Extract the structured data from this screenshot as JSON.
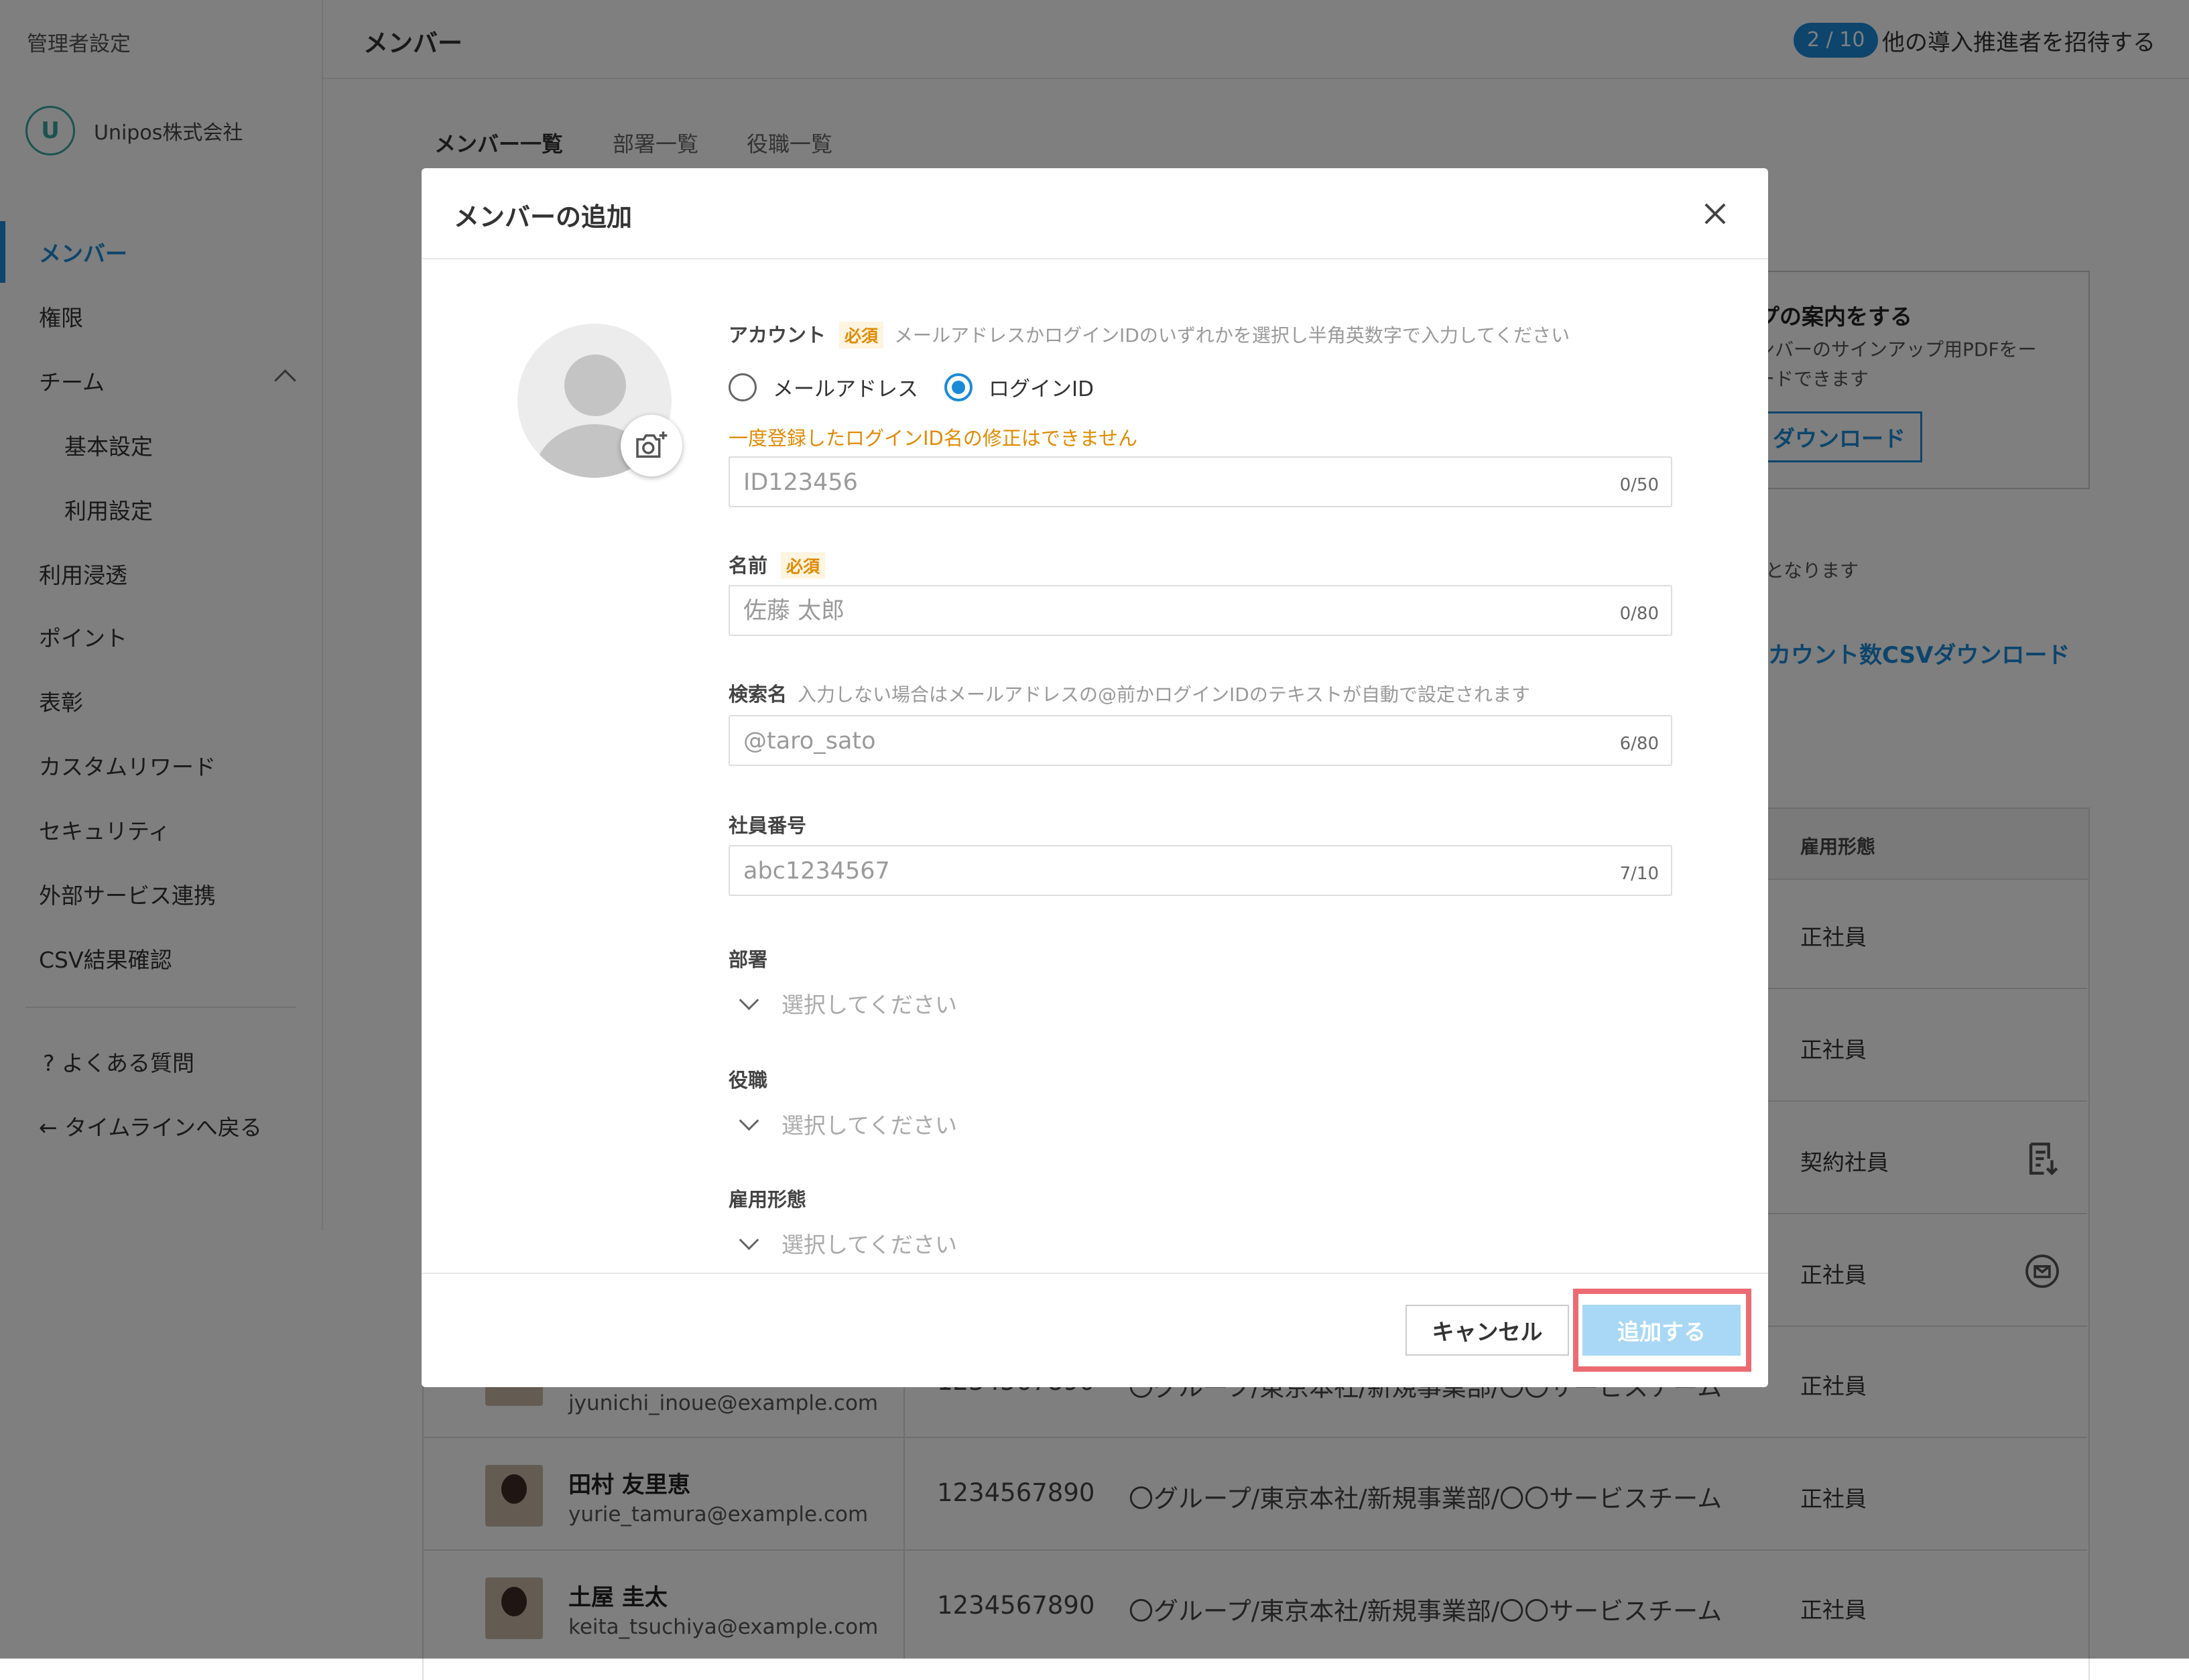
{
  "sidebar": {
    "header": "管理者設定",
    "company": "Unipos株式会社",
    "items": [
      {
        "label": "メンバー"
      },
      {
        "label": "権限"
      },
      {
        "label": "チーム"
      },
      {
        "label": "基本設定"
      },
      {
        "label": "利用設定"
      },
      {
        "label": "利用浸透"
      },
      {
        "label": "ポイント"
      },
      {
        "label": "表彰"
      },
      {
        "label": "カスタムリワード"
      },
      {
        "label": "セキュリティ"
      },
      {
        "label": "外部サービス連携"
      },
      {
        "label": "CSV結果確認"
      }
    ],
    "faq": "よくある質問",
    "back": "タイムラインへ戻る"
  },
  "topbar": {
    "title": "メンバー",
    "count": "2 / 10",
    "invite": "他の導入推進者を招待する"
  },
  "tabs": [
    "メンバー一覧",
    "部署一覧",
    "役職一覧"
  ],
  "card": {
    "title": "プの案内をする",
    "desc": "ンバーのサインアップ用PDFをー\nードできます",
    "button": "ダウンロード"
  },
  "note": "となります",
  "csv_link": "カウント数CSVダウンロード",
  "table": {
    "header_employment": "雇用形態",
    "employment": [
      "正社員",
      "正社員",
      "契約社員",
      "正社員",
      "正社員",
      "正社員",
      "正社員"
    ],
    "people": [
      {
        "name": "",
        "email": "jyunichi_inoue@example.com",
        "id": "1234567890",
        "org": "〇グループ/東京本社/新規事業部/〇〇サービスチーム"
      },
      {
        "name": "田村 友里恵",
        "email": "yurie_tamura@example.com",
        "id": "1234567890",
        "org": "〇グループ/東京本社/新規事業部/〇〇サービスチーム"
      },
      {
        "name": "土屋 圭太",
        "email": "keita_tsuchiya@example.com",
        "id": "1234567890",
        "org": "〇グループ/東京本社/新規事業部/〇〇サービスチーム"
      }
    ]
  },
  "modal": {
    "title": "メンバーの追加",
    "account": {
      "label": "アカウント",
      "required": "必須",
      "hint": "メールアドレスかログインIDのいずれかを選択し半角英数字で入力してください",
      "option_email": "メールアドレス",
      "option_login": "ログインID",
      "selected": "ログインID",
      "warning": "一度登録したログインID名の修正はできません",
      "placeholder": "ID123456",
      "counter": "0/50"
    },
    "name": {
      "label": "名前",
      "required": "必須",
      "placeholder": "佐藤 太郎",
      "counter": "0/80"
    },
    "search_name": {
      "label": "検索名",
      "hint": "入力しない場合はメールアドレスの@前かログインIDのテキストが自動で設定されます",
      "placeholder": "@taro_sato",
      "counter": "6/80"
    },
    "employee_no": {
      "label": "社員番号",
      "placeholder": "abc1234567",
      "counter": "7/10"
    },
    "department": {
      "label": "部署",
      "value": "選択してください"
    },
    "position": {
      "label": "役職",
      "value": "選択してください"
    },
    "employment": {
      "label": "雇用形態",
      "value": "選択してください"
    },
    "cancel": "キャンセル",
    "submit": "追加する"
  },
  "colors": {
    "accent": "#1a8ad8",
    "required": "#e08a00",
    "highlight": "#ec6b72",
    "submit_disabled": "#a8d8f5"
  }
}
